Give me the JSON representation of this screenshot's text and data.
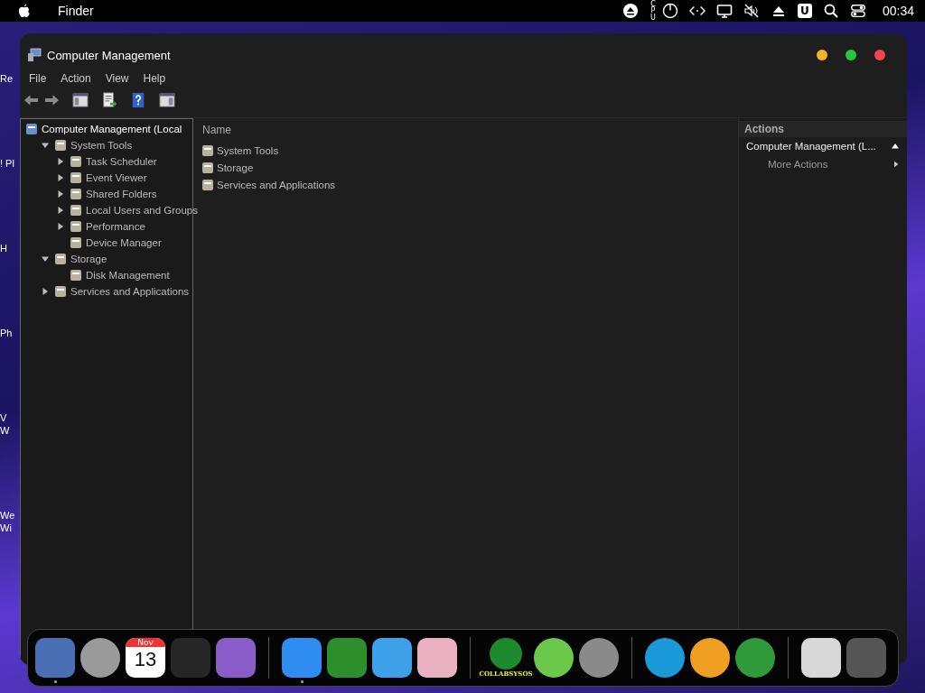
{
  "menubar": {
    "app_name": "Finder",
    "cpu_label": "CPU",
    "badge_letter": "U",
    "clock": "00:34"
  },
  "desktop_labels": [
    {
      "lines": [
        "Re"
      ]
    },
    {
      "lines": [
        "! Pl"
      ]
    },
    {
      "lines": [
        "H"
      ]
    },
    {
      "lines": [
        "Ph"
      ]
    },
    {
      "lines": [
        "V",
        "W"
      ]
    },
    {
      "lines": [
        "We",
        "Wi"
      ]
    }
  ],
  "window": {
    "title": "Computer Management",
    "menu": [
      "File",
      "Action",
      "View",
      "Help"
    ],
    "tree": [
      {
        "label": "Computer Management (Local",
        "selected": true,
        "has_children": false,
        "children": [
          {
            "label": "System Tools",
            "selected": false,
            "has_children": true,
            "expanded": true,
            "children": [
              {
                "label": "Task Scheduler",
                "selected": false,
                "has_children": true,
                "expanded": false
              },
              {
                "label": "Event Viewer",
                "selected": false,
                "has_children": true,
                "expanded": false
              },
              {
                "label": "Shared Folders",
                "selected": false,
                "has_children": true,
                "expanded": false
              },
              {
                "label": "Local Users and Groups",
                "selected": false,
                "has_children": true,
                "expanded": false
              },
              {
                "label": "Performance",
                "selected": false,
                "has_children": true,
                "expanded": false
              },
              {
                "label": "Device Manager",
                "selected": false,
                "has_children": false
              }
            ]
          },
          {
            "label": "Storage",
            "selected": false,
            "has_children": true,
            "expanded": true,
            "children": [
              {
                "label": "Disk Management",
                "selected": false,
                "has_children": false
              }
            ]
          },
          {
            "label": "Services and Applications",
            "selected": false,
            "has_children": true,
            "expanded": false
          }
        ]
      }
    ],
    "list": {
      "column": "Name",
      "rows": [
        "System Tools",
        "Storage",
        "Services and Applications"
      ]
    },
    "actions": {
      "title": "Actions",
      "section": {
        "label": "Computer Management (L...",
        "expanded": true
      },
      "items": [
        "More Actions"
      ]
    }
  },
  "dock": {
    "groups": [
      [
        {
          "kind": "square",
          "color": "#4a6fb5",
          "running": true
        },
        {
          "kind": "circle",
          "color": "#9a9a9a",
          "running": false
        },
        {
          "kind": "calendar",
          "color": "#ffffff",
          "month": "Nov",
          "day": "13",
          "running": false
        },
        {
          "kind": "square",
          "color": "#262626",
          "running": false
        },
        {
          "kind": "square",
          "color": "#8a5cc9",
          "running": false
        }
      ],
      [
        {
          "kind": "square",
          "color": "#2f8cf0",
          "running": true
        },
        {
          "kind": "square",
          "color": "#2c8f2c",
          "running": false
        },
        {
          "kind": "square",
          "color": "#3da0e8",
          "running": false
        },
        {
          "kind": "square",
          "color": "#e8b0c0",
          "running": false
        }
      ],
      [
        {
          "kind": "labeled",
          "color": "#1e8a2e",
          "label": "COLLABSYSOS",
          "running": false
        },
        {
          "kind": "circle",
          "color": "#6cc84a",
          "running": false
        },
        {
          "kind": "circle",
          "color": "#8a8a8a",
          "running": false
        }
      ],
      [
        {
          "kind": "circle",
          "color": "#1a9ad8",
          "running": false
        },
        {
          "kind": "circle",
          "color": "#f0a020",
          "running": false
        },
        {
          "kind": "circle",
          "color": "#2f9a3a",
          "running": false
        }
      ],
      [
        {
          "kind": "square",
          "color": "#d8d8d8",
          "running": false
        },
        {
          "kind": "square",
          "color": "#555555",
          "running": false
        }
      ]
    ]
  }
}
